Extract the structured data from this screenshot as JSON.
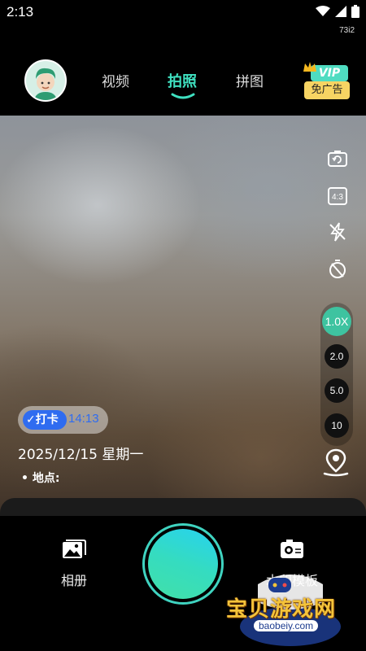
{
  "status_bar": {
    "time": "2:13",
    "sub_text": "73i2"
  },
  "tabs": [
    {
      "label": "视频"
    },
    {
      "label": "拍照",
      "active": true
    },
    {
      "label": "拼图"
    }
  ],
  "vip_badge": {
    "top": "VIP",
    "bottom": "免广告"
  },
  "zoom_levels": [
    "1.0X",
    "2.0",
    "5.0",
    "10"
  ],
  "watermark": {
    "tag": "打卡",
    "time": "14:13",
    "date": "2025/12/15 星期一",
    "location_label": "• 地点:"
  },
  "bottom_bar": {
    "album_label": "相册",
    "template_label": "水印模板"
  },
  "site_overlay": {
    "name": "宝贝游戏网",
    "url": "baobeiy.com"
  },
  "colors": {
    "accent": "#3fe0c0",
    "zoom_active": "#3ec3a0",
    "checkin_blue": "#2f6cf0",
    "vip_yellow": "#f7d463"
  },
  "icons": {
    "flip_camera": "flip-camera-icon",
    "aspect_ratio": "aspect-ratio-icon",
    "flash_off": "flash-off-icon",
    "timer_off": "timer-off-icon",
    "location": "location-pin-icon",
    "album": "album-icon",
    "template": "template-icon"
  }
}
